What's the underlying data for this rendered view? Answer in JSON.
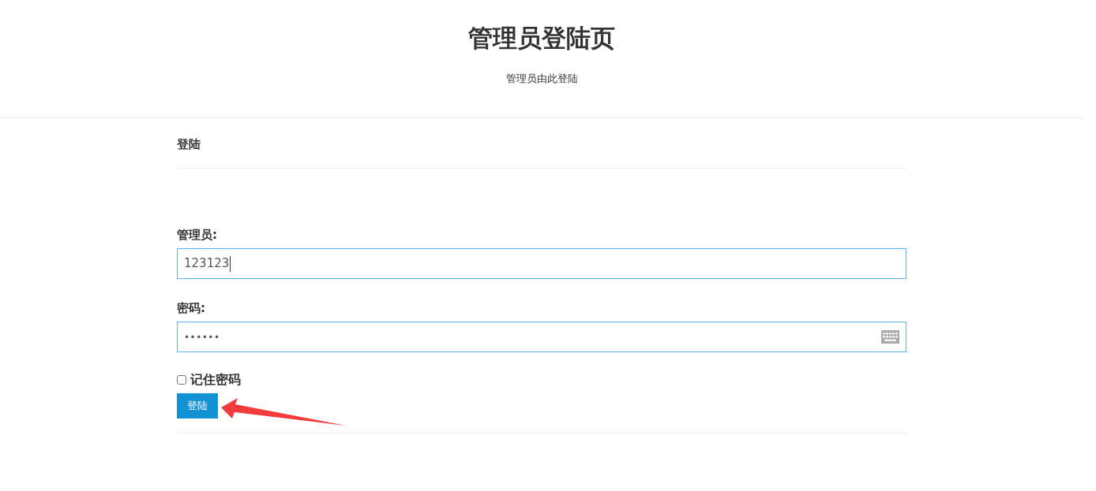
{
  "header": {
    "title": "管理员登陆页",
    "subtitle": "管理员由此登陆"
  },
  "panel": {
    "heading": "登陆"
  },
  "fields": [
    {
      "kind": "text",
      "label": "管理员:",
      "value": "123123",
      "cursor": true
    },
    {
      "kind": "password",
      "label": "密码:",
      "value": "••••••",
      "cursor": false
    }
  ],
  "remember": {
    "label": "记住密码",
    "checked": false
  },
  "submit": {
    "label": "登陆"
  },
  "annotations": [
    {
      "kind": "arrow"
    }
  ]
}
